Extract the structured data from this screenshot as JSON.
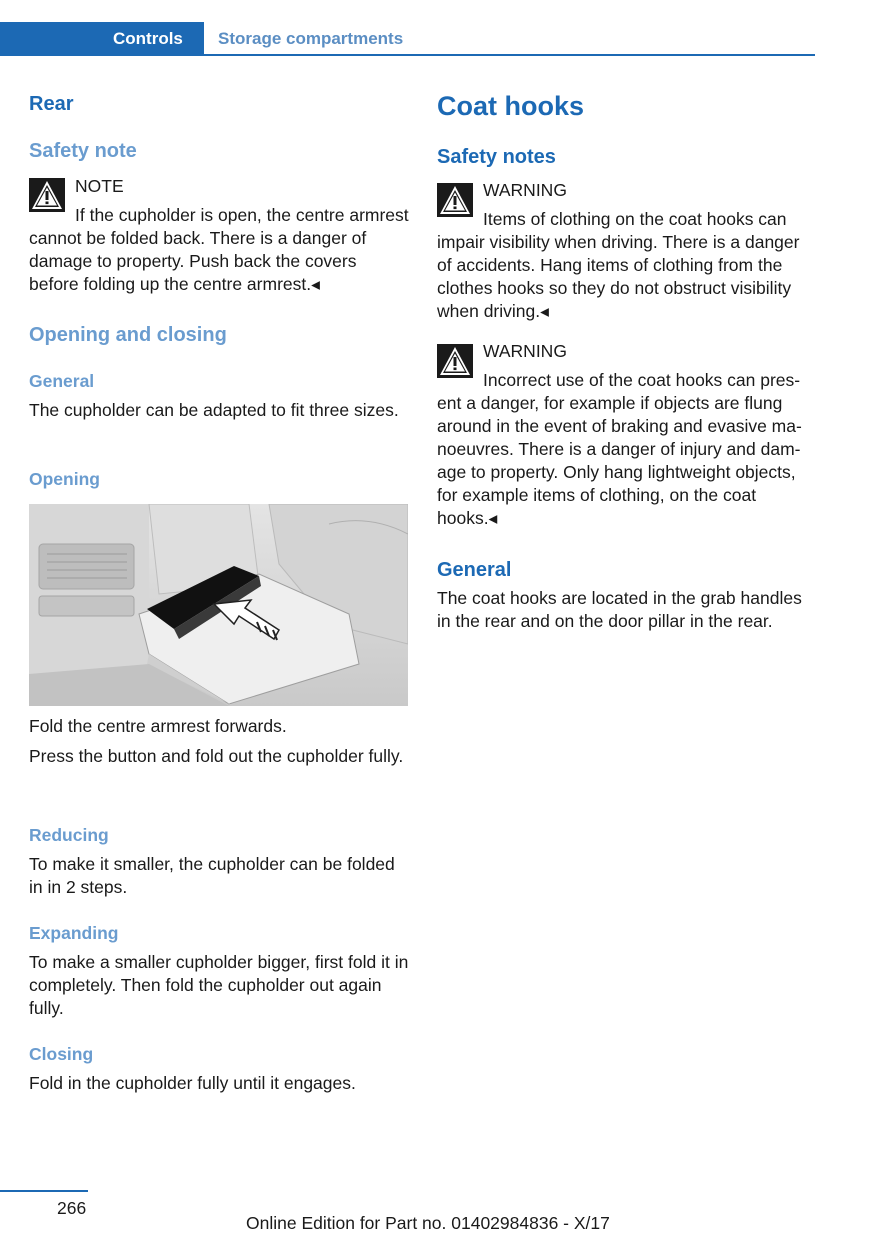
{
  "header": {
    "chapter": "Controls",
    "section": "Storage compartments"
  },
  "left": {
    "rear_title": "Rear",
    "safety_note_title": "Safety note",
    "note_label": "NOTE",
    "note_text": "If the cupholder is open, the centre arm­rest cannot be folded back. There is a danger of damage to property. Push back the covers before folding up the centre armrest.◂",
    "opening_closing_title": "Opening and closing",
    "general_title": "General",
    "general_text": "The cupholder can be adapted to fit three sizes.",
    "opening_title": "Opening",
    "step1": "Fold the centre armrest forwards.",
    "step2": "Press the button and fold out the cupholder fully.",
    "reducing_title": "Reducing",
    "reducing_text": "To make it smaller, the cupholder can be fol­ded in in 2 steps.",
    "expanding_title": "Expanding",
    "expanding_text": "To make a smaller cupholder bigger, first fold it in completely. Then fold the cupholder out again fully.",
    "closing_title": "Closing",
    "closing_text": "Fold in the cupholder fully until it engages."
  },
  "right": {
    "coat_hooks_title": "Coat hooks",
    "safety_notes_title": "Safety notes",
    "warning1_label": "WARNING",
    "warning1_text": "Items of clothing on the coat hooks can impair visibility when driving. There is a danger of accidents. Hang items of clothing from the clothes hooks so they do not obstruct visibility when driving.◂",
    "warning2_label": "WARNING",
    "warning2_text": "Incorrect use of the coat hooks can pres­ent a danger, for example if objects are flung around in the event of braking and evasive ma­noeuvres. There is a danger of injury and dam­age to property. Only hang lightweight objects, for example items of clothing, on the coat hooks.◂",
    "general_title": "General",
    "general_text": "The coat hooks are located in the grab handles in the rear and on the door pillar in the rear."
  },
  "footer": {
    "page_number": "266",
    "edition": "Online Edition for Part no. 01402984836 - X/17"
  },
  "colors": {
    "brand_blue": "#1c69b4",
    "subheading_blue": "#6a9ccf"
  },
  "icons": {
    "warning": "warning-triangle-icon"
  }
}
